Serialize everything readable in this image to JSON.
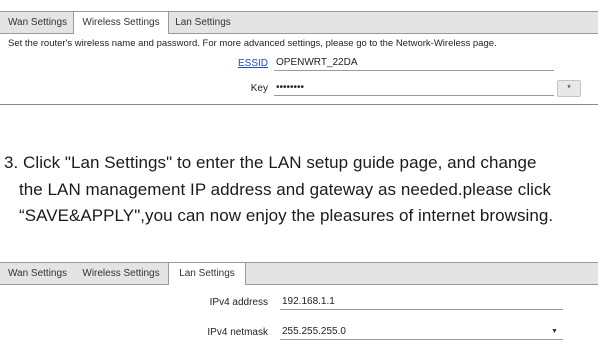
{
  "wireless_panel": {
    "tabs": [
      {
        "label": "Wan Settings",
        "active": false
      },
      {
        "label": "Wireless Settings",
        "active": true
      },
      {
        "label": "Lan Settings",
        "active": false
      }
    ],
    "hint": "Set the router's wireless name and password. For more advanced settings, please go to the Network-Wireless page.",
    "essid": {
      "label": "ESSID",
      "value": "OPENWRT_22DA"
    },
    "key": {
      "label": "Key",
      "value": "••••••••",
      "reveal_button": "*"
    }
  },
  "instructions": {
    "line1": "3. Click \"Lan Settings\" to enter the LAN setup guide page, and change",
    "line2": "the LAN management IP address and gateway as needed.please click",
    "line3": "“SAVE&APPLY\",you can now enjoy the pleasures of internet browsing."
  },
  "lan_panel": {
    "tabs": [
      {
        "label": "Wan Settings",
        "active": false
      },
      {
        "label": "Wireless Settings",
        "active": false
      },
      {
        "label": "Lan Settings",
        "active": true
      }
    ],
    "ipv4_address": {
      "label": "IPv4 address",
      "value": "192.168.1.1"
    },
    "ipv4_netmask": {
      "label": "IPv4 netmask",
      "value": "255.255.255.0",
      "caret": "▼"
    }
  }
}
